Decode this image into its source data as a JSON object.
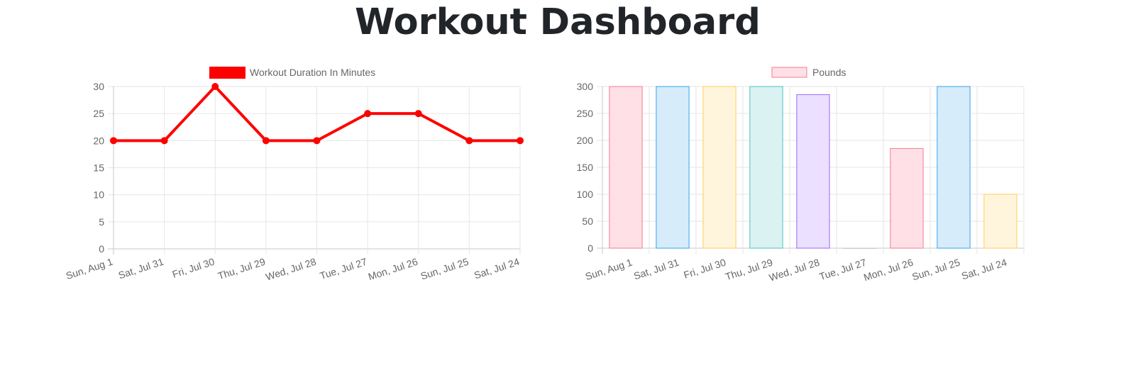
{
  "page": {
    "title": "Workout Dashboard"
  },
  "charts": {
    "duration": {
      "type": "line",
      "legend_label": "Workout Duration In Minutes",
      "legend_position": "top",
      "color": "#ff0000",
      "categories": [
        "Sun, Aug 1",
        "Sat, Jul 31",
        "Fri, Jul 30",
        "Thu, Jul 29",
        "Wed, Jul 28",
        "Tue, Jul 27",
        "Mon, Jul 26",
        "Sun, Jul 25",
        "Sat, Jul 24"
      ],
      "values": [
        20,
        20,
        30,
        20,
        20,
        25,
        25,
        20,
        20
      ],
      "ylim": [
        0,
        30
      ],
      "yticks": [
        0,
        5,
        10,
        15,
        20,
        25,
        30
      ],
      "grid": true
    },
    "pounds": {
      "type": "bar",
      "legend_label": "Pounds",
      "legend_position": "top",
      "legend_fill": "#ffe0e6",
      "legend_stroke": "#f37a95",
      "categories": [
        "Sun, Aug 1",
        "Sat, Jul 31",
        "Fri, Jul 30",
        "Thu, Jul 29",
        "Wed, Jul 28",
        "Tue, Jul 27",
        "Mon, Jul 26",
        "Sun, Jul 25",
        "Sat, Jul 24"
      ],
      "values": [
        300,
        300,
        300,
        300,
        285,
        0,
        185,
        300,
        100
      ],
      "fills": [
        "#ffe0e6",
        "#d7ecfb",
        "#fff5dd",
        "#dbf2f2",
        "#ebe0ff",
        "#f4f5f5",
        "#ffe0e6",
        "#d7ecfb",
        "#fff5dd"
      ],
      "strokes": [
        "#f37a95",
        "#36a2eb",
        "#ffcd56",
        "#4bc0c0",
        "#9966ff",
        "#c9cbcf",
        "#f37a95",
        "#36a2eb",
        "#ffcd56"
      ],
      "ylim": [
        0,
        300
      ],
      "yticks": [
        0,
        50,
        100,
        150,
        200,
        250,
        300
      ],
      "grid": true
    }
  }
}
